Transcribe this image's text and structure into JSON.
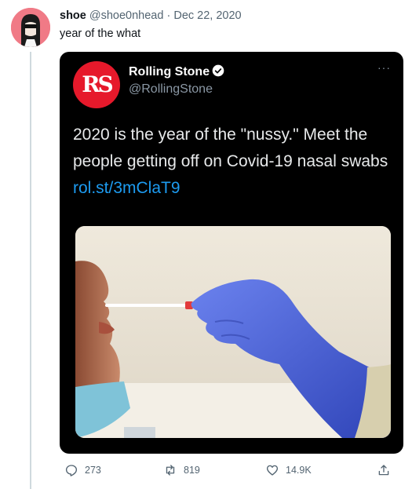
{
  "author": {
    "name": "shoe",
    "handle": "@shoe0nhead",
    "separator": "·",
    "date": "Dec 22, 2020"
  },
  "tweet_text": "year of the what",
  "quoted": {
    "logo_text": "RS",
    "name": "Rolling Stone",
    "handle": "@RollingStone",
    "more_label": "···",
    "text": "2020 is the year of the \"nussy.\" Meet the people getting off on Covid-19 nasal swabs",
    "link": "rol.st/3mClaT9"
  },
  "actions": {
    "replies": "273",
    "retweets": "819",
    "likes": "14.9K"
  },
  "colors": {
    "brand_red": "#e6192b",
    "link_blue": "#1d9bf0",
    "avatar_pink": "#f07a86",
    "glove_blue": "#4a5fd4"
  }
}
